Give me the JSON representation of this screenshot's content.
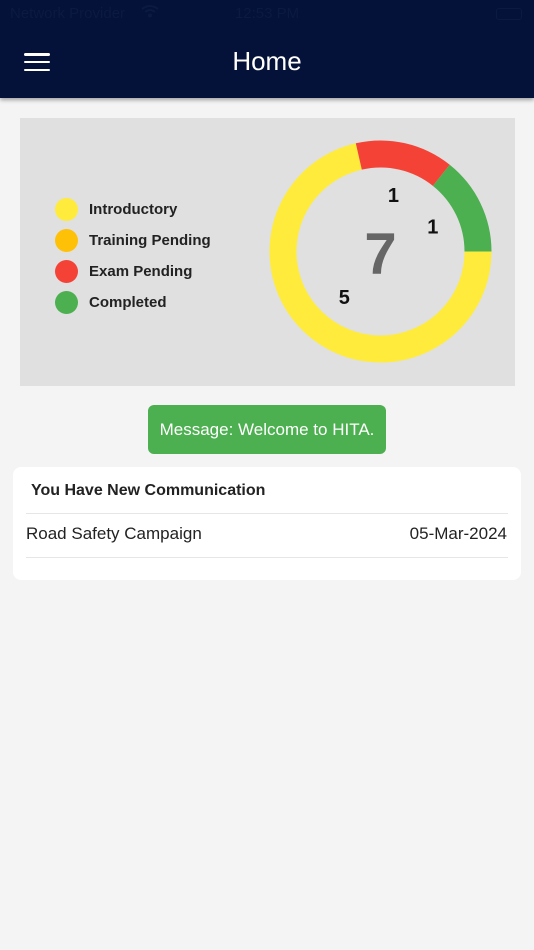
{
  "status_bar": {
    "carrier": "Network Provider",
    "time": "12:53 PM",
    "icons": [
      "wifi-icon",
      "battery-icon"
    ]
  },
  "header": {
    "title": "Home",
    "menu_icon": "hamburger-menu-icon"
  },
  "chart_data": {
    "type": "pie",
    "categories": [
      "Introductory",
      "Training Pending",
      "Exam Pending",
      "Completed"
    ],
    "values": [
      5,
      0,
      1,
      1
    ],
    "colors": [
      "#ffeb3b",
      "#ffc107",
      "#f44336",
      "#4caf50"
    ],
    "center_label": "7",
    "legend_position": "left"
  },
  "message": {
    "text": "Message: Welcome to HITA."
  },
  "communication": {
    "title": "You Have New Communication",
    "items": [
      {
        "title": "Road Safety Campaign",
        "date": "05-Mar-2024"
      }
    ]
  }
}
